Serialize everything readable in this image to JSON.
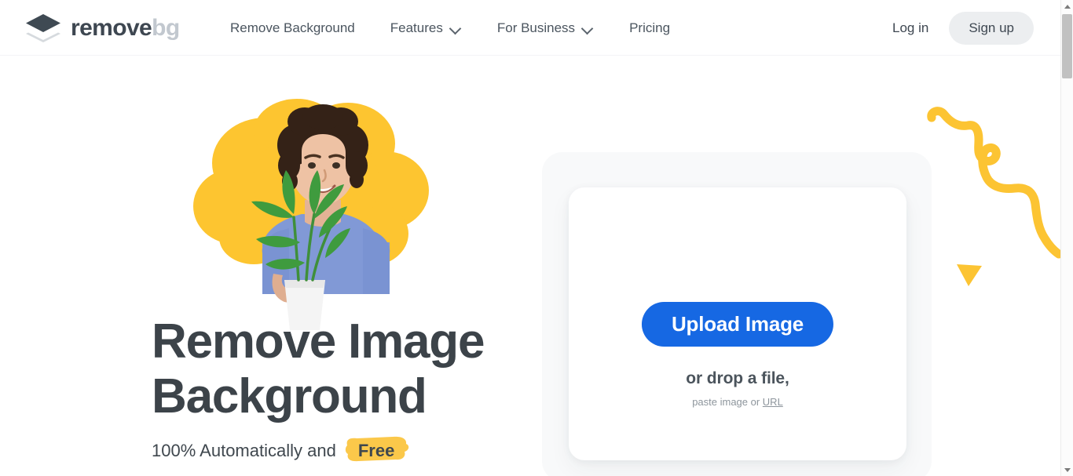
{
  "brand": {
    "name_primary": "remove",
    "name_secondary": "bg",
    "logo_icon": "layers-diamond-icon"
  },
  "header": {
    "nav_items": [
      {
        "label": "Remove Background",
        "has_dropdown": false,
        "icon": ""
      },
      {
        "label": "Features",
        "has_dropdown": true,
        "icon": "chevron-down-icon"
      },
      {
        "label": "For Business",
        "has_dropdown": true,
        "icon": "chevron-down-icon"
      },
      {
        "label": "Pricing",
        "has_dropdown": false,
        "icon": ""
      }
    ],
    "login_label": "Log in",
    "signup_label": "Sign up"
  },
  "hero": {
    "headline_line1": "Remove Image",
    "headline_line2": "Background",
    "subheadline_prefix": "100% Automatically and",
    "subheadline_highlight": "Free",
    "illustration": "person-holding-plant-with-yellow-blob"
  },
  "upload": {
    "button_label": "Upload Image",
    "drop_label": "or drop a file,",
    "paste_prefix": "paste image or ",
    "paste_link_label": "URL"
  },
  "decorations": {
    "squiggle": "yellow-squiggle-line",
    "triangle": "yellow-triangle"
  },
  "scrollbar": {
    "up_arrow": "scroll-up-arrow-icon",
    "down_arrow": "scroll-down-arrow-icon"
  },
  "colors": {
    "accent_blue": "#1668e3",
    "accent_yellow": "#fdc832",
    "highlight_yellow": "#fbc84a",
    "text_dark": "#3c4349",
    "text_muted": "#8d959c",
    "logo_secondary": "#c2c8cf",
    "signup_bg": "#eceef0",
    "card_outer_bg": "#f8f9fa",
    "page_bg": "#ffffff"
  }
}
